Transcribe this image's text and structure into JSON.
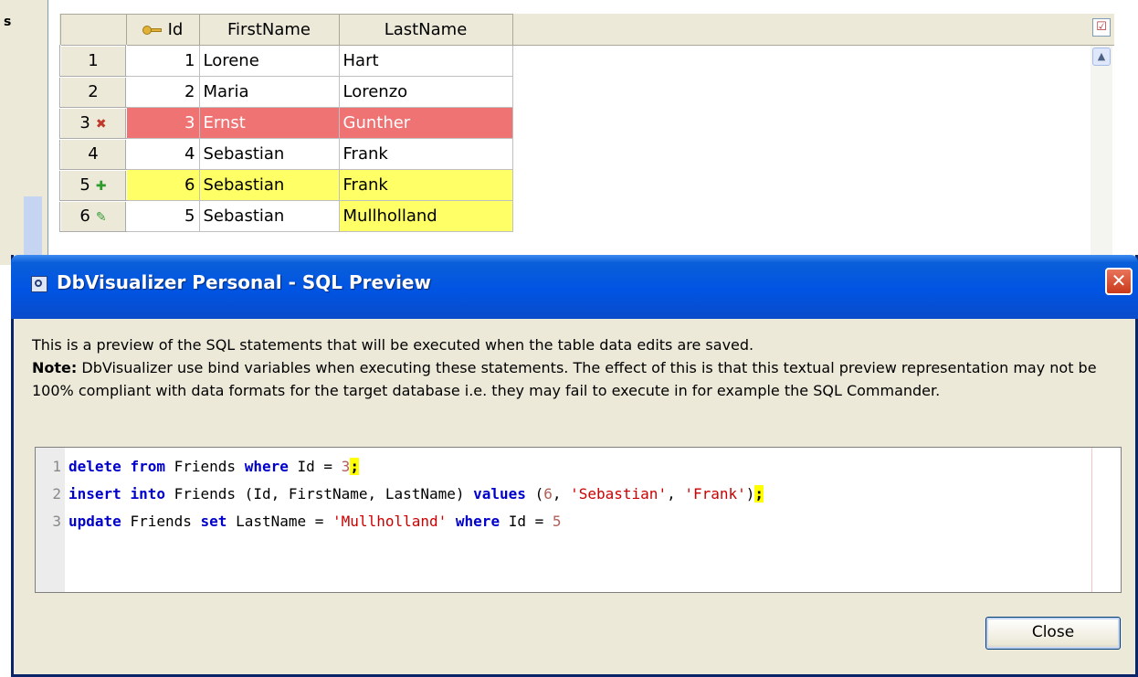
{
  "grid": {
    "left_label": "s",
    "headers": [
      "Id",
      "FirstName",
      "LastName"
    ],
    "check_icon": "checklist-icon",
    "rows": [
      {
        "num": "1",
        "marker": "",
        "id": "1",
        "first": "Lorene",
        "last": "Hart",
        "state": "normal"
      },
      {
        "num": "2",
        "marker": "",
        "id": "2",
        "first": "Maria",
        "last": "Lorenzo",
        "state": "normal"
      },
      {
        "num": "3",
        "marker": "✖",
        "id": "3",
        "first": "Ernst",
        "last": "Gunther",
        "state": "deleted"
      },
      {
        "num": "4",
        "marker": "",
        "id": "4",
        "first": "Sebastian",
        "last": "Frank",
        "state": "normal"
      },
      {
        "num": "5",
        "marker": "✚",
        "id": "6",
        "first": "Sebastian",
        "last": "Frank",
        "state": "inserted"
      },
      {
        "num": "6",
        "marker": "✎",
        "id": "5",
        "first": "Sebastian",
        "last": "Mullholland",
        "state": "updated"
      }
    ],
    "colors": {
      "deleted": "#ef7373",
      "changed": "#ffff66"
    }
  },
  "dialog": {
    "title": "DbVisualizer Personal - SQL Preview",
    "close_glyph": "✕",
    "intro": "This is a preview of the SQL statements that will be executed when the table data edits are saved.",
    "note_label": "Note:",
    "note_text": " DbVisualizer use bind variables when executing these statements. The effect of this is that this textual preview representation may not be 100% compliant with data formats for the target database i.e. they may fail to execute in for example the SQL Commander.",
    "sql_lines": [
      {
        "n": "1",
        "text": "delete from Friends where Id = 3;"
      },
      {
        "n": "2",
        "text": "insert into Friends (Id, FirstName, LastName) values (6, 'Sebastian', 'Frank');"
      },
      {
        "n": "3",
        "text": "update Friends set LastName = 'Mullholland' where Id = 5"
      }
    ],
    "close_label": "Close"
  }
}
